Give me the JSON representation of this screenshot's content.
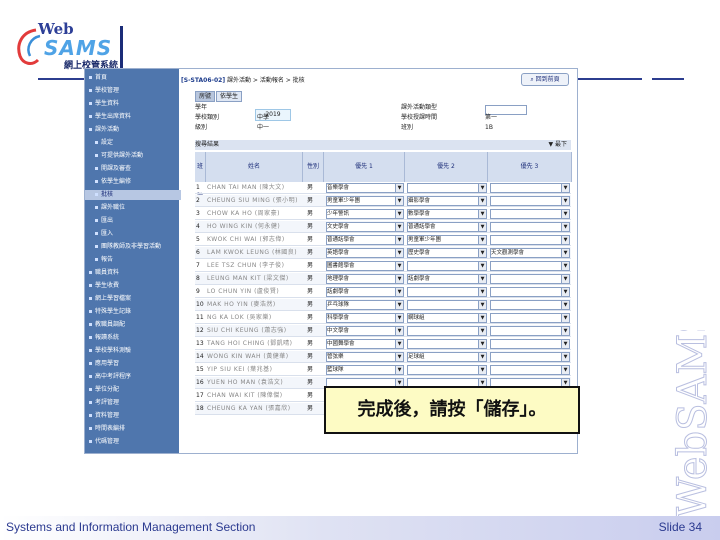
{
  "slide": {
    "footer_text": "Systems and Information Management Section",
    "slide_number": "Slide 34",
    "watermark": "WebSAMS",
    "callout": "完成後，請按「儲存」。"
  },
  "logo": {
    "web": "Web",
    "sams": "SAMS",
    "cn": "網上校管系統"
  },
  "colors": {
    "sidebar": "#4f76ad",
    "brand_blue": "#2d3f97",
    "callout_bg": "#fdfbc4"
  },
  "app": {
    "breadcrumb_code": "[S-STA06-02]",
    "breadcrumb_path": " 課外活動 > 活動報名 > 批核",
    "back_button": "回到前頁",
    "tabs": [
      "房號",
      "依學生"
    ],
    "info": {
      "year_label": "學年",
      "year_value": "2019",
      "school_label": "學校類別",
      "school_value": "中學",
      "level_label": "級別",
      "level_value": "中一",
      "type_label": "課外活動類型",
      "session_label": "學校授課時間",
      "session_value": "第一",
      "class_label": "班別",
      "class_value": "1B"
    },
    "result_label": "搜尋結果",
    "sort_label": "▼ 最下",
    "columns": [
      "班號",
      "姓名",
      "性別",
      "優先 1",
      "優先 2",
      "優先 3"
    ]
  },
  "sidebar": {
    "items": [
      {
        "label": "首頁",
        "level": 0,
        "active": false
      },
      {
        "label": "學校管理",
        "level": 0,
        "active": false
      },
      {
        "label": "學生資料",
        "level": 0,
        "active": false
      },
      {
        "label": "學生出席資料",
        "level": 0,
        "active": false
      },
      {
        "label": "課外活動",
        "level": 0,
        "active": false
      },
      {
        "label": "設定",
        "level": 1,
        "active": false
      },
      {
        "label": "可提供課外活動",
        "level": 1,
        "active": false
      },
      {
        "label": "開課及審查",
        "level": 1,
        "active": false
      },
      {
        "label": "依學生編修",
        "level": 1,
        "active": false
      },
      {
        "label": "批核",
        "level": 1,
        "active": true
      },
      {
        "label": "課外職位",
        "level": 1,
        "active": false
      },
      {
        "label": "匯出",
        "level": 1,
        "active": false
      },
      {
        "label": "匯入",
        "level": 1,
        "active": false
      },
      {
        "label": "團隊教師及非學習活動",
        "level": 1,
        "active": false
      },
      {
        "label": "報告",
        "level": 1,
        "active": false
      },
      {
        "label": "職員資料",
        "level": 0,
        "active": false
      },
      {
        "label": "學生收費",
        "level": 0,
        "active": false
      },
      {
        "label": "網上學習檔案",
        "level": 0,
        "active": false
      },
      {
        "label": "特殊學生記錄",
        "level": 0,
        "active": false
      },
      {
        "label": "教職員調配",
        "level": 0,
        "active": false
      },
      {
        "label": "報讀系統",
        "level": 0,
        "active": false
      },
      {
        "label": "學校學科測驗",
        "level": 0,
        "active": false
      },
      {
        "label": "應用學習",
        "level": 0,
        "active": false
      },
      {
        "label": "高中考評程序",
        "level": 0,
        "active": false
      },
      {
        "label": "學位分配",
        "level": 0,
        "active": false
      },
      {
        "label": "考評管理",
        "level": 0,
        "active": false
      },
      {
        "label": "資料管理",
        "level": 0,
        "active": false
      },
      {
        "label": "時間表編排",
        "level": 0,
        "active": false
      },
      {
        "label": "代碼管理",
        "level": 0,
        "active": false
      }
    ]
  },
  "rows": [
    {
      "num": "1",
      "name": "CHAN TAI MAN (陳大文)",
      "sex": "男",
      "p1": "音樂學會",
      "p2": "",
      "p3": ""
    },
    {
      "num": "2",
      "name": "CHEUNG SIU MING (張小明)",
      "sex": "男",
      "p1": "男童軍少年團",
      "p2": "攝影學會",
      "p3": ""
    },
    {
      "num": "3",
      "name": "CHOW KA HO (周家豪)",
      "sex": "男",
      "p1": "少年警訊",
      "p2": "數學學會",
      "p3": ""
    },
    {
      "num": "4",
      "name": "HO WING KIN (何永健)",
      "sex": "男",
      "p1": "文史學會",
      "p2": "普通話學會",
      "p3": ""
    },
    {
      "num": "5",
      "name": "KWOK CHI WAI (郭志偉)",
      "sex": "男",
      "p1": "普通話學會",
      "p2": "男童軍少年團",
      "p3": ""
    },
    {
      "num": "6",
      "name": "LAM KWOK LEUNG (林國良)",
      "sex": "男",
      "p1": "英語學會",
      "p2": "歷史學會",
      "p3": "天文觀測學會"
    },
    {
      "num": "7",
      "name": "LEE TSZ CHUN (李子俊)",
      "sex": "男",
      "p1": "圖書館學會",
      "p2": "",
      "p3": ""
    },
    {
      "num": "8",
      "name": "LEUNG MAN KIT (梁文傑)",
      "sex": "男",
      "p1": "地理學會",
      "p2": "話劇學會",
      "p3": ""
    },
    {
      "num": "9",
      "name": "LO CHUN YIN (盧俊賢)",
      "sex": "男",
      "p1": "話劇學會",
      "p2": "",
      "p3": ""
    },
    {
      "num": "10",
      "name": "MAK HO YIN (麥浩然)",
      "sex": "男",
      "p1": "乒乓球隊",
      "p2": "",
      "p3": ""
    },
    {
      "num": "11",
      "name": "NG KA LOK (吳家樂)",
      "sex": "男",
      "p1": "科學學會",
      "p2": "網球組",
      "p3": ""
    },
    {
      "num": "12",
      "name": "SIU CHI KEUNG (蕭志強)",
      "sex": "男",
      "p1": "中文學會",
      "p2": "",
      "p3": ""
    },
    {
      "num": "13",
      "name": "TANG HOI CHING (鄧凱晴)",
      "sex": "男",
      "p1": "中國舞學會",
      "p2": "",
      "p3": ""
    },
    {
      "num": "14",
      "name": "WONG KIN WAH (黃健華)",
      "sex": "男",
      "p1": "管弦樂",
      "p2": "足球組",
      "p3": ""
    },
    {
      "num": "15",
      "name": "YIP SIU KEI (葉兆基)",
      "sex": "男",
      "p1": "籃球隊",
      "p2": "",
      "p3": ""
    },
    {
      "num": "16",
      "name": "YUEN HO MAN (袁浩文)",
      "sex": "男",
      "p1": "",
      "p2": "",
      "p3": ""
    },
    {
      "num": "17",
      "name": "CHAN WAI KIT (陳偉傑)",
      "sex": "男",
      "p1": "國畫學會",
      "p2": "話劇學會",
      "p3": ""
    },
    {
      "num": "18",
      "name": "CHEUNG KA YAN (張嘉欣)",
      "sex": "男",
      "p1": "乒乓球",
      "p2": "",
      "p3": ""
    }
  ]
}
